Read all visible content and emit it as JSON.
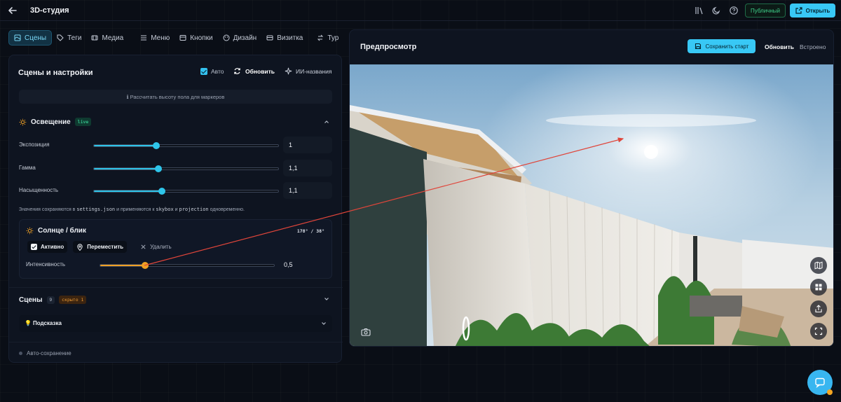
{
  "app": {
    "title": "3D-студия"
  },
  "topbar": {
    "public_label": "Публичный",
    "open_label": "Открыть"
  },
  "tabs": [
    {
      "label": "Сцены",
      "icon": "scenes-icon",
      "active": true
    },
    {
      "label": "Теги",
      "icon": "tag-icon"
    },
    {
      "label": "Медиа",
      "icon": "media-icon"
    },
    {
      "label": "Меню",
      "icon": "menu-icon"
    },
    {
      "label": "Кнопки",
      "icon": "buttons-icon"
    },
    {
      "label": "Дизайн",
      "icon": "palette-icon"
    },
    {
      "label": "Визитка",
      "icon": "card-icon"
    },
    {
      "label": "Тур",
      "icon": "tour-icon"
    }
  ],
  "panel": {
    "title": "Сцены и настройки",
    "auto_label": "Авто",
    "refresh_label": "Обновить",
    "ai_names_label": "ИИ-названия",
    "calc_height_label": "ℹ Рассчитать высоту пола для маркеров"
  },
  "lighting": {
    "title": "Освещение",
    "badge": "live",
    "sliders": [
      {
        "label": "Экспозиция",
        "value": "1",
        "fraction": 0.34
      },
      {
        "label": "Гамма",
        "value": "1,1",
        "fraction": 0.35
      },
      {
        "label": "Насыщенность",
        "value": "1,1",
        "fraction": 0.37
      }
    ],
    "note_prefix": "Значения сохраняются в ",
    "note_code1": "settings.json",
    "note_mid": " и применяются к ",
    "note_code2": "skybox",
    "note_and": " и ",
    "note_code3": "projection",
    "note_suffix": " одновременно."
  },
  "sun": {
    "title": "Солнце / блик",
    "angle": "178° / 38°",
    "active_label": "Активно",
    "move_label": "Переместить",
    "delete_label": "Удалить",
    "intensity_label": "Интенсивность",
    "intensity_value": "0,5",
    "intensity_fraction": 0.26
  },
  "scenes": {
    "title": "Сцены",
    "count": "9",
    "hidden": "скрыто 1"
  },
  "hint": {
    "label": "Подсказка"
  },
  "autosave": {
    "label": "Авто-сохранение"
  },
  "preview": {
    "title": "Предпросмотр",
    "save_start_label": "Сохранить старт",
    "refresh_label": "Обновить",
    "embed_label": "Встроено"
  },
  "colors": {
    "accent": "#38c8f5",
    "slider": "#2ec5ea",
    "sun_slider": "#f0a024",
    "public": "#3fd18b"
  }
}
